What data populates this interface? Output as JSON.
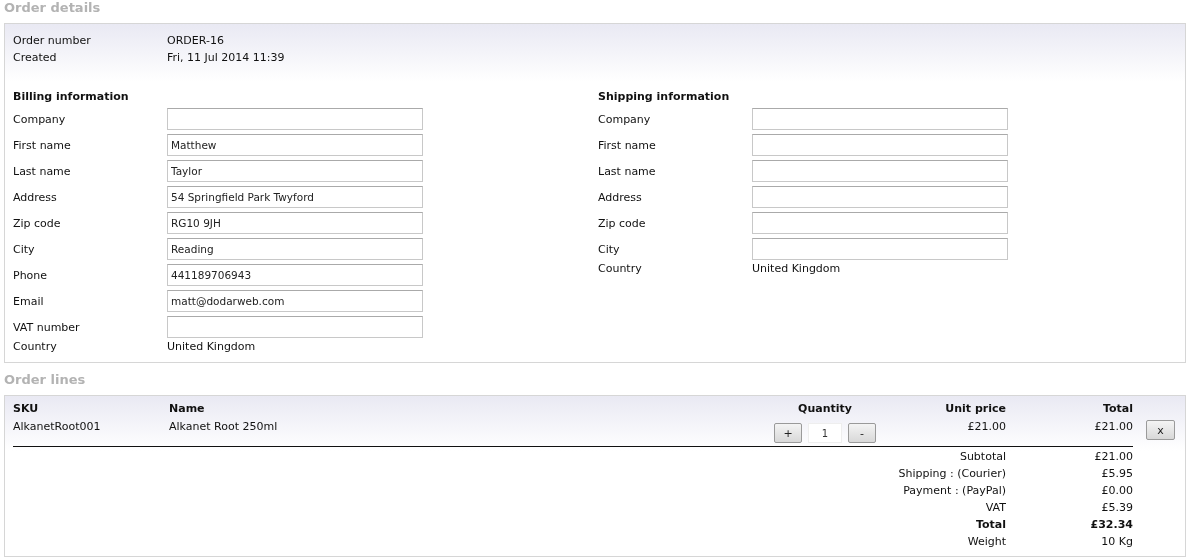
{
  "order_details": {
    "title": "Order details",
    "meta": [
      {
        "label": "Order number",
        "value": "ORDER-16"
      },
      {
        "label": "Created",
        "value": "Fri, 11 Jul 2014 11:39"
      }
    ],
    "billing": {
      "title": "Billing information",
      "fields": [
        {
          "label": "Company",
          "kind": "input"
        },
        {
          "label": "First name",
          "kind": "input",
          "value": "Matthew"
        },
        {
          "label": "Last name",
          "kind": "input",
          "value": "Taylor"
        },
        {
          "label": "Address",
          "kind": "input",
          "value": "54 Springfield Park Twyford"
        },
        {
          "label": "Zip code",
          "kind": "input",
          "value": "RG10 9JH"
        },
        {
          "label": "City",
          "kind": "input",
          "value": "Reading"
        },
        {
          "label": "Phone",
          "kind": "input",
          "value": "441189706943"
        },
        {
          "label": "Email",
          "kind": "input",
          "value": "matt@dodarweb.com"
        },
        {
          "label": "VAT number",
          "kind": "input"
        },
        {
          "label": "Country",
          "kind": "text",
          "value": "United Kingdom"
        }
      ]
    },
    "shipping": {
      "title": "Shipping information",
      "fields": [
        {
          "label": "Company",
          "kind": "input"
        },
        {
          "label": "First name",
          "kind": "input"
        },
        {
          "label": "Last name",
          "kind": "input"
        },
        {
          "label": "Address",
          "kind": "input"
        },
        {
          "label": "Zip code",
          "kind": "input"
        },
        {
          "label": "City",
          "kind": "input"
        },
        {
          "label": "Country",
          "kind": "text",
          "value": "United Kingdom"
        }
      ]
    }
  },
  "order_lines": {
    "title": "Order lines",
    "columns": [
      "SKU",
      "Name",
      "Quantity",
      "Unit price",
      "Total"
    ],
    "rows": [
      {
        "sku": "AlkanetRoot001",
        "name": "Alkanet Root 250ml",
        "increase": "+",
        "quantity": "1",
        "decrease": "-",
        "unit_price": "£21.00",
        "total": "£21.00",
        "remove": "x"
      }
    ],
    "totals": [
      {
        "label": "Subtotal",
        "value": "£21.00",
        "emphasized": false
      },
      {
        "label": "Shipping : (Courier)",
        "value": "£5.95",
        "emphasized": false
      },
      {
        "label": "Payment : (PayPal)",
        "value": "£0.00",
        "emphasized": false
      },
      {
        "label": "VAT",
        "value": "£5.39",
        "emphasized": false
      },
      {
        "label": "Total",
        "value": "£32.34",
        "emphasized": true
      },
      {
        "label": "Weight",
        "value": "10 Kg",
        "emphasized": false
      }
    ]
  }
}
